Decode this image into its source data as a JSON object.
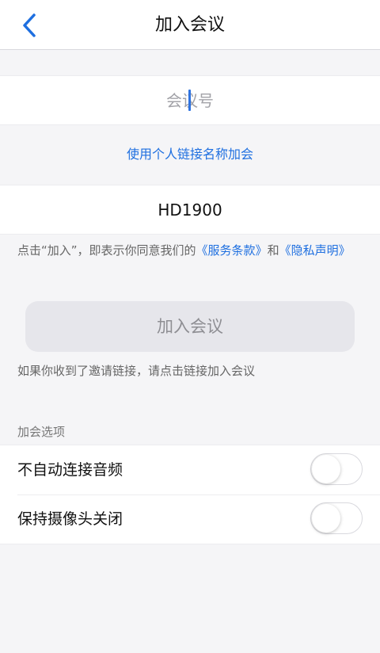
{
  "header": {
    "title": "加入会议",
    "back_icon": "chevron-left-icon"
  },
  "meeting_number": {
    "placeholder": "会议号",
    "value": ""
  },
  "personal_link_label": "使用个人链接名称加会",
  "display_name": {
    "value": "HD1900"
  },
  "terms": {
    "prefix": "点击“加入”，即表示你同意我们的",
    "terms_link": "《服务条款》",
    "middle": "和",
    "privacy_link": "《隐私声明》"
  },
  "join_button_label": "加入会议",
  "invite_hint": "如果你收到了邀请链接，请点击链接加入会议",
  "options": {
    "section_title": "加会选项",
    "items": [
      {
        "label": "不自动连接音频",
        "enabled": false
      },
      {
        "label": "保持摄像头关闭",
        "enabled": false
      }
    ]
  },
  "colors": {
    "accent": "#1e6fe0",
    "background": "#f5f5f7",
    "disabled_button": "#e6e6eb"
  }
}
